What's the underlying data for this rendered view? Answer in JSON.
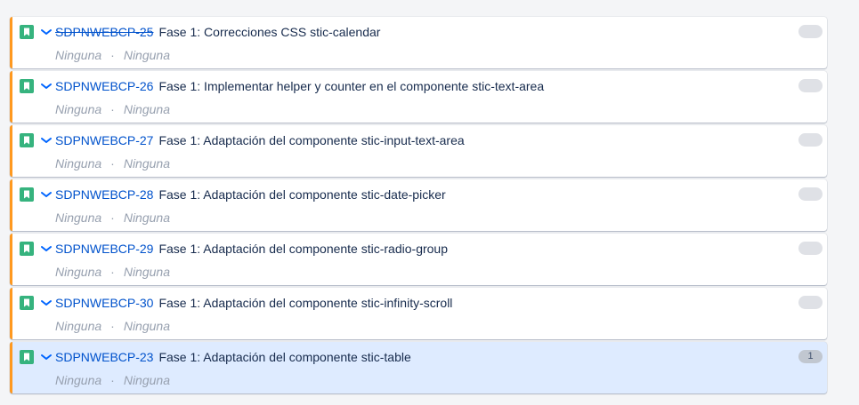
{
  "colors": {
    "accent_border": "#ff991f",
    "story_icon": "#36b37e",
    "key_link": "#0052cc",
    "selected_bg": "#deebff"
  },
  "issues": [
    {
      "key": "SDPNWEBCP-25",
      "done": true,
      "summary": "Fase 1: Correcciones CSS stic-calendar",
      "meta_left": "Ninguna",
      "meta_right": "Ninguna",
      "estimate": "",
      "selected": false,
      "type_icon": "story-icon",
      "priority_icon": "chevron-down-icon"
    },
    {
      "key": "SDPNWEBCP-26",
      "done": false,
      "summary": "Fase 1: Implementar helper y counter en el componente stic-text-area",
      "meta_left": "Ninguna",
      "meta_right": "Ninguna",
      "estimate": "",
      "selected": false,
      "type_icon": "story-icon",
      "priority_icon": "chevron-down-icon"
    },
    {
      "key": "SDPNWEBCP-27",
      "done": false,
      "summary": "Fase 1: Adaptación del componente stic-input-text-area",
      "meta_left": "Ninguna",
      "meta_right": "Ninguna",
      "estimate": "",
      "selected": false,
      "type_icon": "story-icon",
      "priority_icon": "chevron-down-icon"
    },
    {
      "key": "SDPNWEBCP-28",
      "done": false,
      "summary": "Fase 1: Adaptación del componente stic-date-picker",
      "meta_left": "Ninguna",
      "meta_right": "Ninguna",
      "estimate": "",
      "selected": false,
      "type_icon": "story-icon",
      "priority_icon": "chevron-down-icon"
    },
    {
      "key": "SDPNWEBCP-29",
      "done": false,
      "summary": "Fase 1: Adaptación del componente stic-radio-group",
      "meta_left": "Ninguna",
      "meta_right": "Ninguna",
      "estimate": "",
      "selected": false,
      "type_icon": "story-icon",
      "priority_icon": "chevron-down-icon"
    },
    {
      "key": "SDPNWEBCP-30",
      "done": false,
      "summary": "Fase 1: Adaptación del componente stic-infinity-scroll",
      "meta_left": "Ninguna",
      "meta_right": "Ninguna",
      "estimate": "",
      "selected": false,
      "type_icon": "story-icon",
      "priority_icon": "chevron-down-icon"
    },
    {
      "key": "SDPNWEBCP-23",
      "done": false,
      "summary": "Fase 1: Adaptación del componente stic-table",
      "meta_left": "Ninguna",
      "meta_right": "Ninguna",
      "estimate": "1",
      "selected": true,
      "type_icon": "story-icon",
      "priority_icon": "chevron-down-icon"
    }
  ]
}
